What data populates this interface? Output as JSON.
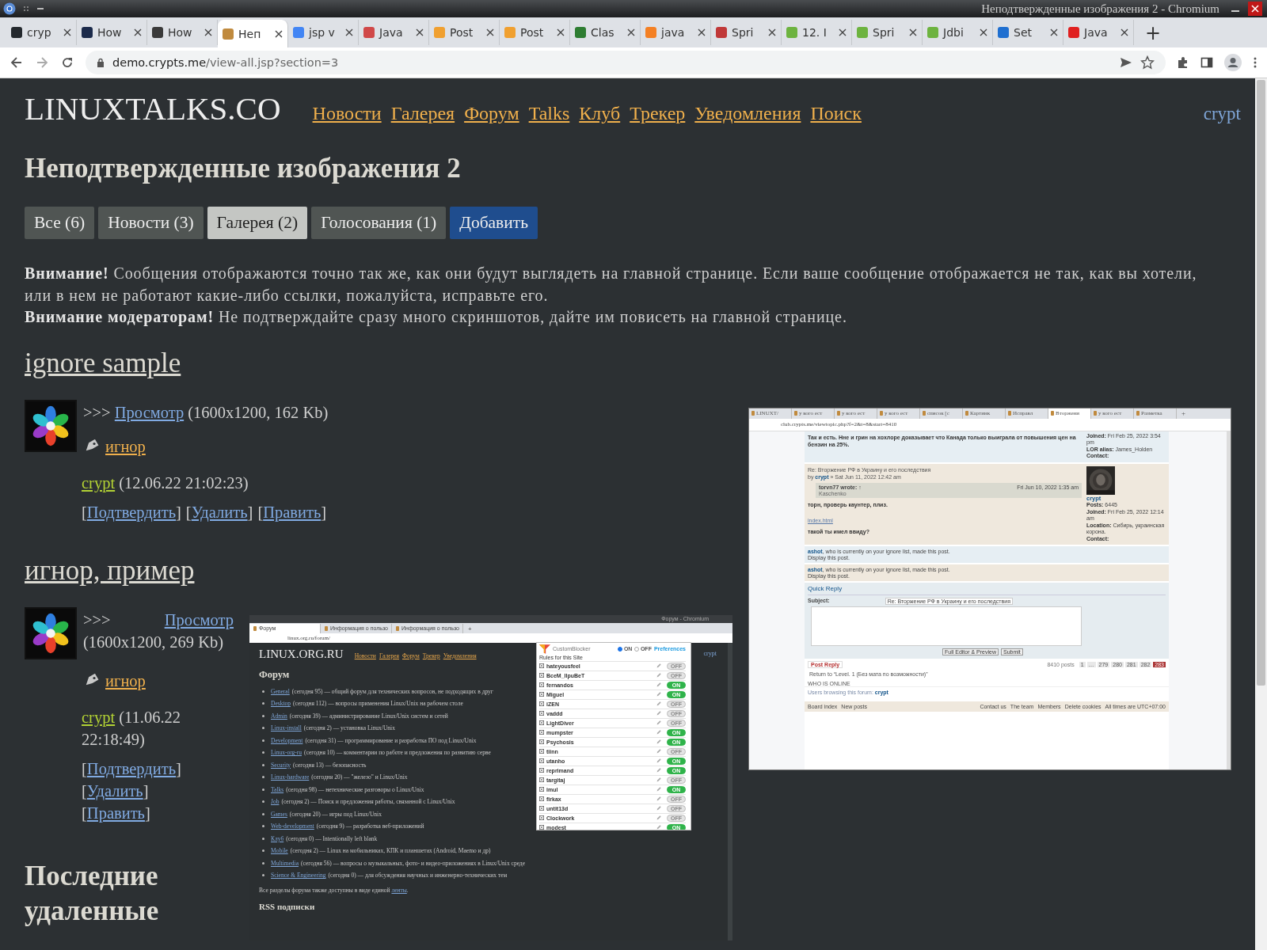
{
  "browser": {
    "window_title": "Неподтвержденные изображения 2 - Chromium",
    "tabs": [
      {
        "label": "cryp",
        "selected": false,
        "color": "#24292e"
      },
      {
        "label": "How",
        "selected": false,
        "color": "#1b2a4a"
      },
      {
        "label": "How",
        "selected": false,
        "color": "#3a3a3a"
      },
      {
        "label": "Неп",
        "selected": true,
        "color": "#c08a3e"
      },
      {
        "label": "jsp v",
        "selected": false,
        "color": "#4285f4"
      },
      {
        "label": "Java",
        "selected": false,
        "color": "#d04848"
      },
      {
        "label": "Post",
        "selected": false,
        "color": "#f0a030"
      },
      {
        "label": "Post",
        "selected": false,
        "color": "#f0a030"
      },
      {
        "label": "Clas",
        "selected": false,
        "color": "#2e7d32"
      },
      {
        "label": "java",
        "selected": false,
        "color": "#f48024"
      },
      {
        "label": "Spri",
        "selected": false,
        "color": "#c03838"
      },
      {
        "label": "12. I",
        "selected": false,
        "color": "#6db33f"
      },
      {
        "label": "Spri",
        "selected": false,
        "color": "#6db33f"
      },
      {
        "label": "Jdbi",
        "selected": false,
        "color": "#6db33f"
      },
      {
        "label": "Set",
        "selected": false,
        "color": "#1f6fd0"
      },
      {
        "label": "Java",
        "selected": false,
        "color": "#e02020"
      }
    ],
    "new_tab": "+",
    "address": {
      "host": "demo.crypts.me",
      "path": "/view-all.jsp?section=3"
    }
  },
  "site": {
    "logo": "LINUXTALKS.CO",
    "nav": [
      "Новости",
      "Галерея",
      "Форум",
      "Talks",
      "Клуб",
      "Трекер",
      "Уведомления",
      "Поиск"
    ],
    "user": "crypt"
  },
  "page": {
    "title": "Неподтвержденные изображения 2",
    "filters": [
      {
        "label": "Все (6)",
        "selected": false
      },
      {
        "label": "Новости (3)",
        "selected": false
      },
      {
        "label": "Галерея (2)",
        "selected": true
      },
      {
        "label": "Голосования (1)",
        "selected": false
      }
    ],
    "add_button": "Добавить",
    "notices": [
      "**Внимание!** Сообщения отображаются точно так же, как они будут выглядеть на главной странице. Если ваше сообщение отображается не так, как вы хотели, или в нем не работают какие-либо ссылки, пожалуйста, исправьте его.",
      "**Внимание модераторам!** Не подтверждайте сразу много скриншотов, дайте им повисеть на главной странице."
    ]
  },
  "posts": [
    {
      "title": "ignore sample",
      "prefix": ">>>",
      "view_link": "Просмотр",
      "info": "(1600x1200, 162 Kb)",
      "tag": "игнор",
      "author": "crypt",
      "date": "(12.06.22 21:02:23)",
      "actions": [
        {
          "before": "[",
          "label": "Подтвердить",
          "after": "]"
        },
        {
          "before": "[",
          "label": "Удалить",
          "after": "]"
        },
        {
          "before": "[",
          "label": "Править",
          "after": "]"
        }
      ],
      "screenshot": {
        "kind": "phpbb",
        "tabs": [
          {
            "label": "LINUXT/",
            "selected": false
          },
          {
            "label": "у кого ест",
            "selected": false
          },
          {
            "label": "у кого ест",
            "selected": false
          },
          {
            "label": "у кого ест",
            "selected": false
          },
          {
            "label": "список [с",
            "selected": false
          },
          {
            "label": "Картинк",
            "selected": false
          },
          {
            "label": "Исправл",
            "selected": false
          },
          {
            "label": "Вторжени",
            "selected": true
          },
          {
            "label": "у кого ест",
            "selected": false
          },
          {
            "label": "Разметка",
            "selected": false
          }
        ],
        "new_tab": "+",
        "address": "club.crypts.me/viewtopic.php?f=2&t=8&start=8410",
        "first_post": {
          "text": "Так и есть. Нне и грин на хохлоре доказывает что Канада только выиграла от повышения цен на бензин на 25%.",
          "profile": [
            "**Joined:** Fri Feb 25, 2022 3:54 pm",
            "**LOR alias:** James_Holden",
            "**Contact:**"
          ]
        },
        "reply": {
          "subject": "Re: Вторжение РФ в Украину и его последствия",
          "byline": "by",
          "author": "crypt",
          "date": "» Sat Jun 11, 2022 12:42 am",
          "quote_author": "torvn77 wrote: ↑",
          "quote_date": "Fri Jun 10, 2022 1:35 am",
          "quote_text": "Kaschenko",
          "lines": [
            {
              "kind": "text",
              "text": "торн, проверь каунтер, плиз."
            },
            {
              "kind": "link",
              "text": "index.html"
            },
            {
              "kind": "text",
              "text": "такой ты имел ввиду?"
            }
          ],
          "profile_name": "crypt",
          "profile": [
            "**Posts:** 6445",
            "**Joined:** Fri Feb 25, 2022 12:14 am",
            "**Location:** Сибирь, украинская корона.",
            "**Contact:**"
          ]
        },
        "ignored": [
          {
            "user": "ashot",
            "text": ", who is currently on your ignore list, made this post.",
            "link": "Display this post."
          },
          {
            "user": "ashot",
            "text": ", who is currently on your ignore list, made this post.",
            "link": "Display this post."
          }
        ],
        "quick_reply": {
          "title": "Quick Reply",
          "subject_label": "Subject:",
          "subject_value": "Re: Вторжение РФ в Украину и его последствия",
          "buttons": [
            "Full Editor & Preview",
            "Submit"
          ]
        },
        "post_reply": "Post Reply",
        "return_link": "Return to “Level. 1 (Без мата по возможности)”",
        "post_count": "8410 posts",
        "pages": [
          {
            "label": "1",
            "selected": false
          },
          {
            "label": "…",
            "selected": false
          },
          {
            "label": "279",
            "selected": false
          },
          {
            "label": "280",
            "selected": false
          },
          {
            "label": "281",
            "selected": false
          },
          {
            "label": "282",
            "selected": false
          },
          {
            "label": "283",
            "selected": true
          }
        ],
        "online": {
          "title": "WHO IS ONLINE",
          "text": "Users browsing this forum:",
          "user": "crypt"
        },
        "footer_left": [
          "Board index",
          "New posts"
        ],
        "footer_right": [
          "Contact us",
          "The team",
          "Members",
          "Delete cookies"
        ],
        "timezone": "All times are UTC+07:00"
      }
    },
    {
      "title": "игнор, пример",
      "prefix": ">>>",
      "view_link": "Просмотр",
      "info": "(1600x1200, 269 Kb)",
      "tag": "игнор",
      "author": "crypt",
      "date": "(11.06.22 22:18:49)",
      "actions": [
        {
          "before": "[",
          "label": "Подтвердить",
          "after": "]"
        },
        {
          "before": "[",
          "label": "Удалить",
          "after": "]"
        },
        {
          "before": "[",
          "label": "Править",
          "after": "]"
        }
      ],
      "screenshot": {
        "kind": "lor_forum",
        "window_title": "Форум - Chromium",
        "tabs": [
          {
            "label": "Форум",
            "selected": true
          },
          {
            "label": "Информация о пользо",
            "selected": false
          },
          {
            "label": "Информация о пользо",
            "selected": false
          }
        ],
        "new_tab": "+",
        "address": "linux.org.ru/forum/",
        "logo": "LINUX.ORG.RU",
        "nav": [
          "Новости",
          "Галерея",
          "Форум",
          "Трекер",
          "Уведомления"
        ],
        "user": "crypt",
        "title": "Форум",
        "sections": [
          {
            "link": "General",
            "text": "(сегодня 95) — общий форум для технических вопросов, не подходящих в друг"
          },
          {
            "link": "Desktop",
            "text": "(сегодня 112) — вопросы применения Linux/Unix на рабочем столе"
          },
          {
            "link": "Admin",
            "text": "(сегодня 39) — администрирование Linux/Unix систем и сетей"
          },
          {
            "link": "Linux-install",
            "text": "(сегодня 2) — установка Linux/Unix"
          },
          {
            "link": "Development",
            "text": "(сегодня 31) — программирование и разработка ПО под Linux/Unix"
          },
          {
            "link": "Linux-org-ru",
            "text": "(сегодня 10) — комментарии по работе и предложения по развитию серве"
          },
          {
            "link": "Security",
            "text": "(сегодня 13) — безопасность"
          },
          {
            "link": "Linux-hardware",
            "text": "(сегодня 20) — \"железо\" и Linux/Unix"
          },
          {
            "link": "Talks",
            "text": "(сегодня 98) — нетехнические разговоры о Linux/Unix"
          },
          {
            "link": "Job",
            "text": "(сегодня 2) — Поиск и предложения работы, связанной с Linux/Unix"
          },
          {
            "link": "Games",
            "text": "(сегодня 20) — игры под Linux/Unix"
          },
          {
            "link": "Web-development",
            "text": "(сегодня 9) — разработка веб-приложений"
          },
          {
            "link": "Клуб",
            "text": "(сегодня 0) — Intentionally left blank"
          },
          {
            "link": "Mobile",
            "text": "(сегодня 2) — Linux на мобильниках, КПК и планшетах (Android, Maemo и др)"
          },
          {
            "link": "Multimedia",
            "text": "(сегодня 56) — вопросы о музыкальных, фото- и видео-приложениях в Linux/Unix среде"
          },
          {
            "link": "Science & Engineering",
            "text": "(сегодня 0) — для обсуждения научных и инженерно-технических тем"
          }
        ],
        "footer": {
          "text": "Все разделы форума также доступны в виде единой",
          "link": "ленты",
          "after": "."
        },
        "rss_title": "RSS подписки",
        "blocker": {
          "name": "CustomBlocker",
          "modes": [
            {
              "label": "ON",
              "selected": true
            },
            {
              "label": "OFF",
              "selected": false
            }
          ],
          "preferences": "Preferences",
          "heading": "Rules for this Site",
          "rules": [
            {
              "name": "hateyousfeel",
              "on": false,
              "toggle": "OFF"
            },
            {
              "name": "BceM_llpuBeT",
              "on": false,
              "toggle": "OFF"
            },
            {
              "name": "fernandos",
              "on": true,
              "toggle": "ON"
            },
            {
              "name": "Miguel",
              "on": true,
              "toggle": "ON"
            },
            {
              "name": "iZEN",
              "on": false,
              "toggle": "OFF"
            },
            {
              "name": "vaddd",
              "on": false,
              "toggle": "OFF"
            },
            {
              "name": "LightDiver",
              "on": false,
              "toggle": "OFF"
            },
            {
              "name": "mumpster",
              "on": true,
              "toggle": "ON"
            },
            {
              "name": "Psychosis",
              "on": true,
              "toggle": "ON"
            },
            {
              "name": "tiinn",
              "on": false,
              "toggle": "OFF"
            },
            {
              "name": "utanho",
              "on": true,
              "toggle": "ON"
            },
            {
              "name": "reprimand",
              "on": true,
              "toggle": "ON"
            },
            {
              "name": "targitaj",
              "on": false,
              "toggle": "OFF"
            },
            {
              "name": "imul",
              "on": true,
              "toggle": "ON"
            },
            {
              "name": "firkax",
              "on": false,
              "toggle": "OFF"
            },
            {
              "name": "untit13d",
              "on": false,
              "toggle": "OFF"
            },
            {
              "name": "Clockwork",
              "on": false,
              "toggle": "OFF"
            },
            {
              "name": "modest",
              "on": true,
              "toggle": "ON"
            }
          ]
        }
      }
    }
  ],
  "deleted_title": "Последние удаленные"
}
